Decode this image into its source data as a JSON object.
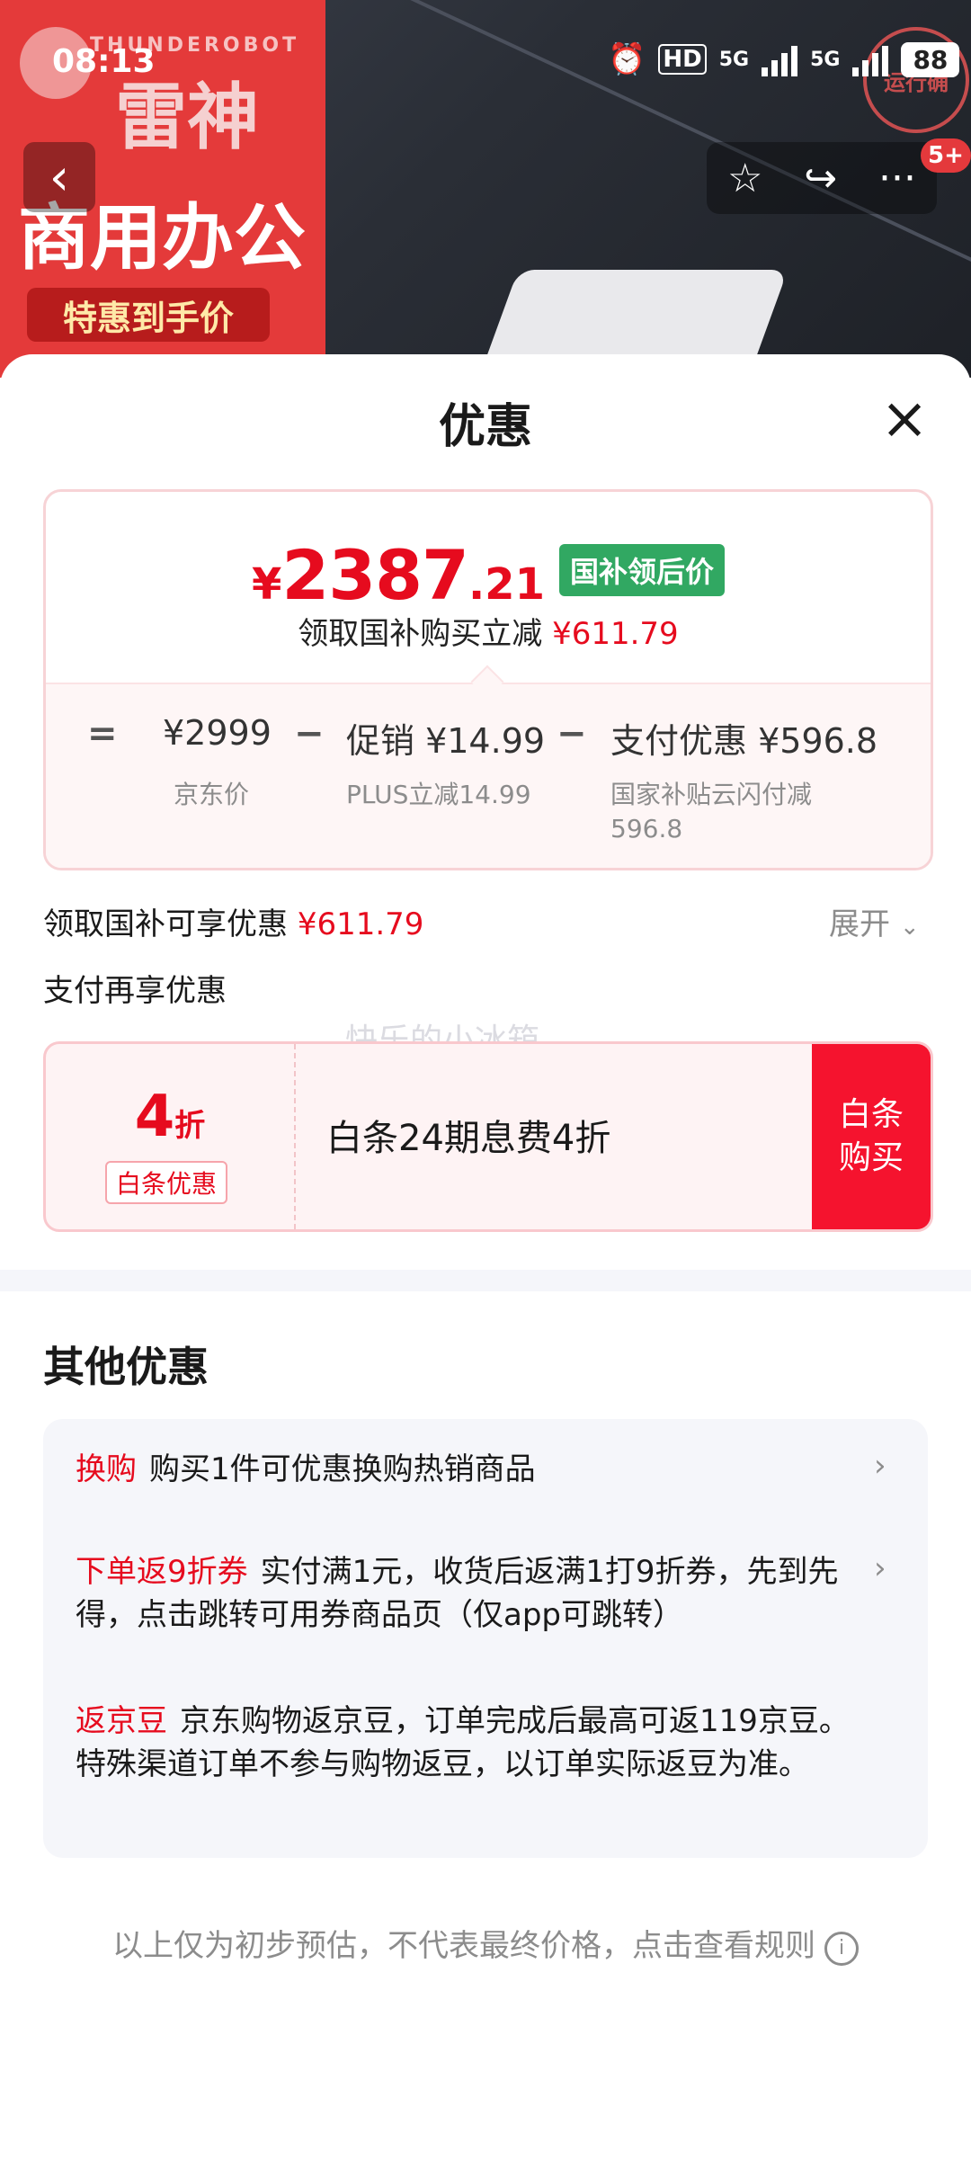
{
  "status_bar": {
    "time": "08:13",
    "hd": "HD",
    "net1": "5G",
    "net2": "5G",
    "battery": "88"
  },
  "background": {
    "brand_en": "THUNDEROBOT",
    "brand_cn": "雷神",
    "poster_title": "商用办公",
    "poster_tag": "特惠到手价",
    "stamp": "运行确"
  },
  "nav": {
    "back_icon": "chevron-left-icon",
    "badge": "5+"
  },
  "sheet": {
    "title": "优惠",
    "price": {
      "yen": "¥",
      "integer": "2387",
      "decimal": ".21",
      "tag": "国补领后价"
    },
    "subline": {
      "text": "领取国补购买立减",
      "amount": "¥611.79"
    },
    "formula": [
      {
        "op": "=",
        "amount": "¥2999",
        "label": "京东价"
      },
      {
        "op": "−",
        "amount": "促销 ¥14.99",
        "label": "PLUS立减14.99"
      },
      {
        "op": "−",
        "amount": "支付优惠 ¥596.8",
        "label": "国家补贴云闪付减 596.8"
      }
    ],
    "guobu_row": {
      "label": "领取国补可享优惠",
      "amount": "¥611.79",
      "expand": "展开"
    },
    "pay_row": {
      "label": "支付再享优惠"
    },
    "watermark": "快乐的小冰箱",
    "coupon": {
      "discount_num": "4",
      "discount_unit": "折",
      "badge": "白条优惠",
      "desc": "白条24期息费4折",
      "button_line1": "白条",
      "button_line2": "购买"
    },
    "other": {
      "title": "其他优惠",
      "items": [
        {
          "tag": "换购",
          "text": "购买1件可优惠换购热销商品"
        },
        {
          "tag": "下单返9折券",
          "text": "实付满1元，收货后返满1打9折券，先到先得，点击跳转可用券商品页（仅app可跳转）"
        },
        {
          "tag": "返京豆",
          "text": "京东购物返京豆，订单完成后最高可返119京豆。特殊渠道订单不参与购物返豆，以订单实际返豆为准。"
        }
      ]
    },
    "footer": "以上仅为初步预估，不代表最终价格，点击查看规则"
  },
  "colors": {
    "accent": "#e60b1e",
    "green_tag": "#31a862",
    "button_red": "#f5132e"
  }
}
